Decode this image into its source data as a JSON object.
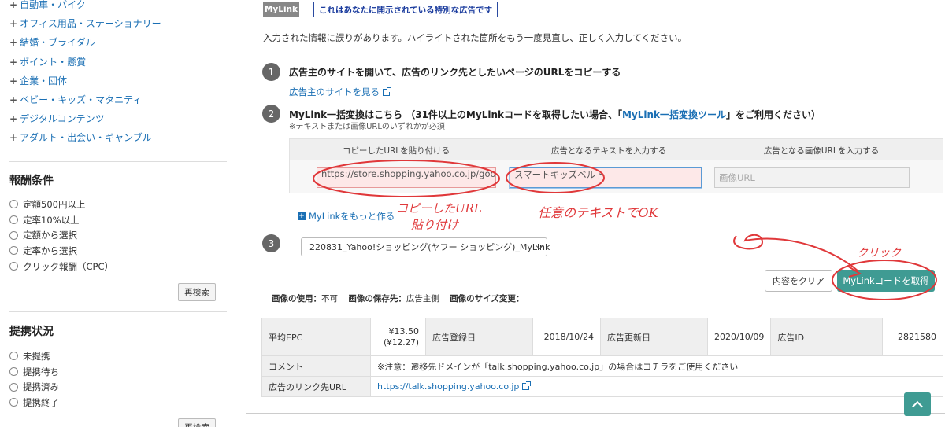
{
  "sidebar": {
    "categories": [
      "自動車・バイク",
      "オフィス用品・ステーショナリー",
      "結婚・ブライダル",
      "ポイント・懸賞",
      "企業・団体",
      "ベビー・キッズ・マタニティ",
      "デジタルコンテンツ",
      "アダルト・出会い・ギャンブル"
    ],
    "reward": {
      "heading": "報酬条件",
      "options": [
        "定額500円以上",
        "定率10%以上",
        "定額から選択",
        "定率から選択",
        "クリック報酬（CPC）"
      ],
      "button": "再検索"
    },
    "status": {
      "heading": "提携状況",
      "options": [
        "未提携",
        "提携待ち",
        "提携済み",
        "提携終了"
      ],
      "button": "再検索"
    }
  },
  "main": {
    "tag": "MyLink",
    "ad_notice": "これはあなたに開示されている特別な広告です",
    "error_message": "入力された情報に誤りがあります。ハイライトされた箇所をもう一度見直し、正しく入力してください。",
    "step1": {
      "num": "1",
      "title": "広告主のサイトを開いて、広告のリンク先としたいページのURLをコピーする",
      "link": "広告主のサイトを見る"
    },
    "step2": {
      "num": "2",
      "title_a": "MyLink一括変換はこちら （31件以上のMyLinkコードを取得したい場合、「",
      "title_link": "MyLink一括変換ツール",
      "title_b": "」をご利用ください）",
      "note": "※テキストまたは画像URLのいずれかが必須",
      "col1": "コピーしたURLを貼り付ける",
      "col2": "広告となるテキストを入力する",
      "col3": "広告となる画像URLを入力する",
      "url_value": "https://store.shopping.yahoo.co.jp/good-",
      "text_value": "スマートキッズベルト",
      "image_placeholder": "画像URL",
      "more_link": "MyLinkをもっと作る"
    },
    "step3": {
      "num": "3",
      "select_value": "220831_Yahoo!ショッピング(ヤフー ショッピング)_MyLink"
    },
    "buttons": {
      "clear": "内容をクリア",
      "get": "MyLinkコードを取得"
    },
    "image_options": {
      "use_label": "画像の使用：",
      "use_value": "不可",
      "save_label": "画像の保存先：",
      "save_value": "広告主側",
      "resize_label": "画像のサイズ変更："
    },
    "info_table": {
      "epc_label": "平均EPC",
      "epc_value": "¥13.50",
      "epc_sub": "(¥12.27)",
      "reg_label": "広告登録日",
      "reg_value": "2018/10/24",
      "upd_label": "広告更新日",
      "upd_value": "2020/10/09",
      "id_label": "広告ID",
      "id_value": "2821580",
      "comment_label": "コメント",
      "comment_value": "※注意：遷移先ドメインが「talk.shopping.yahoo.co.jp」の場合はコチラをご使用ください",
      "url_label": "広告のリンク先URL",
      "url_value": "https://talk.shopping.yahoo.co.jp"
    }
  },
  "annotations": {
    "paste_note_1": "コピーしたURL",
    "paste_note_2": "貼り付け",
    "text_note": "任意のテキストでOK",
    "click_note": "クリック",
    "color": "#e0383a"
  }
}
